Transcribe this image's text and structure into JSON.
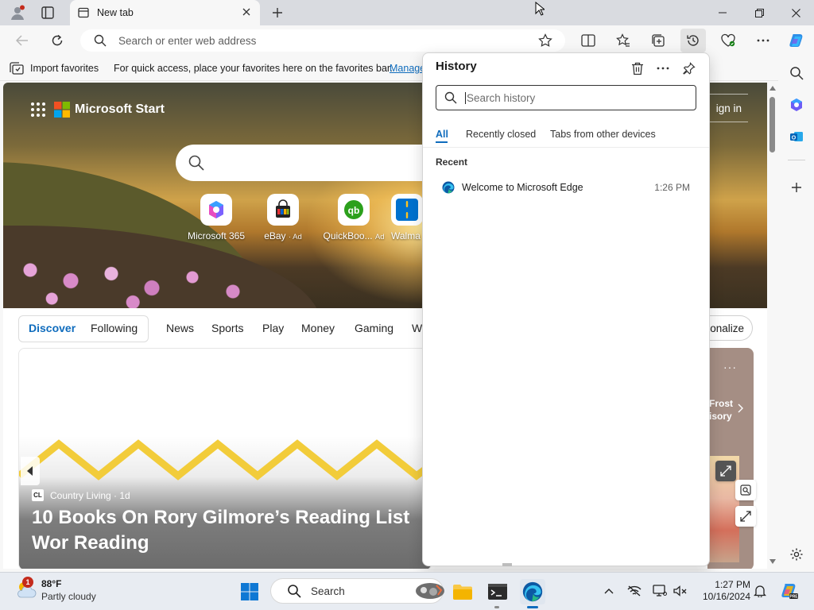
{
  "browser": {
    "tab_title": "New tab",
    "address_placeholder": "Search or enter web address"
  },
  "favorites_bar": {
    "import_label": "Import favorites",
    "message": "For quick access, place your favorites here on the favorites bar.",
    "manage_link": "Manage"
  },
  "start_page": {
    "brand": "Microsoft Start",
    "sign_in": "ign in",
    "quick_links": [
      {
        "label": "Microsoft 365",
        "ad": ""
      },
      {
        "label": "eBay",
        "ad": "· Ad"
      },
      {
        "label": "QuickBoo...",
        "ad": "Ad"
      },
      {
        "label": "Walma",
        "ad": ""
      }
    ],
    "feed_nav": [
      "Discover",
      "Following",
      "News",
      "Sports",
      "Play",
      "Money",
      "Gaming",
      "W"
    ],
    "personalize": "onalize",
    "article": {
      "source_logo": "CL",
      "source": "Country Living · 1d",
      "headline": "10 Books On Rory Gilmore’s Reading List Wor Reading"
    },
    "side_card": {
      "dots": "···",
      "text": "Frost\nisory"
    }
  },
  "history_panel": {
    "title": "History",
    "search_placeholder": "Search history",
    "tabs": [
      "All",
      "Recently closed",
      "Tabs from other devices"
    ],
    "section": "Recent",
    "items": [
      {
        "title": "Welcome to Microsoft Edge",
        "time": "1:26 PM"
      }
    ]
  },
  "taskbar": {
    "weather_badge": "1",
    "temperature": "88°F",
    "condition": "Partly cloudy",
    "search_label": "Search",
    "time": "1:27 PM",
    "date": "10/16/2024"
  },
  "colors": {
    "accent": "#0f6cbd",
    "tab_strip": "#d9dbe0",
    "taskbar": "#e8ecf2"
  }
}
